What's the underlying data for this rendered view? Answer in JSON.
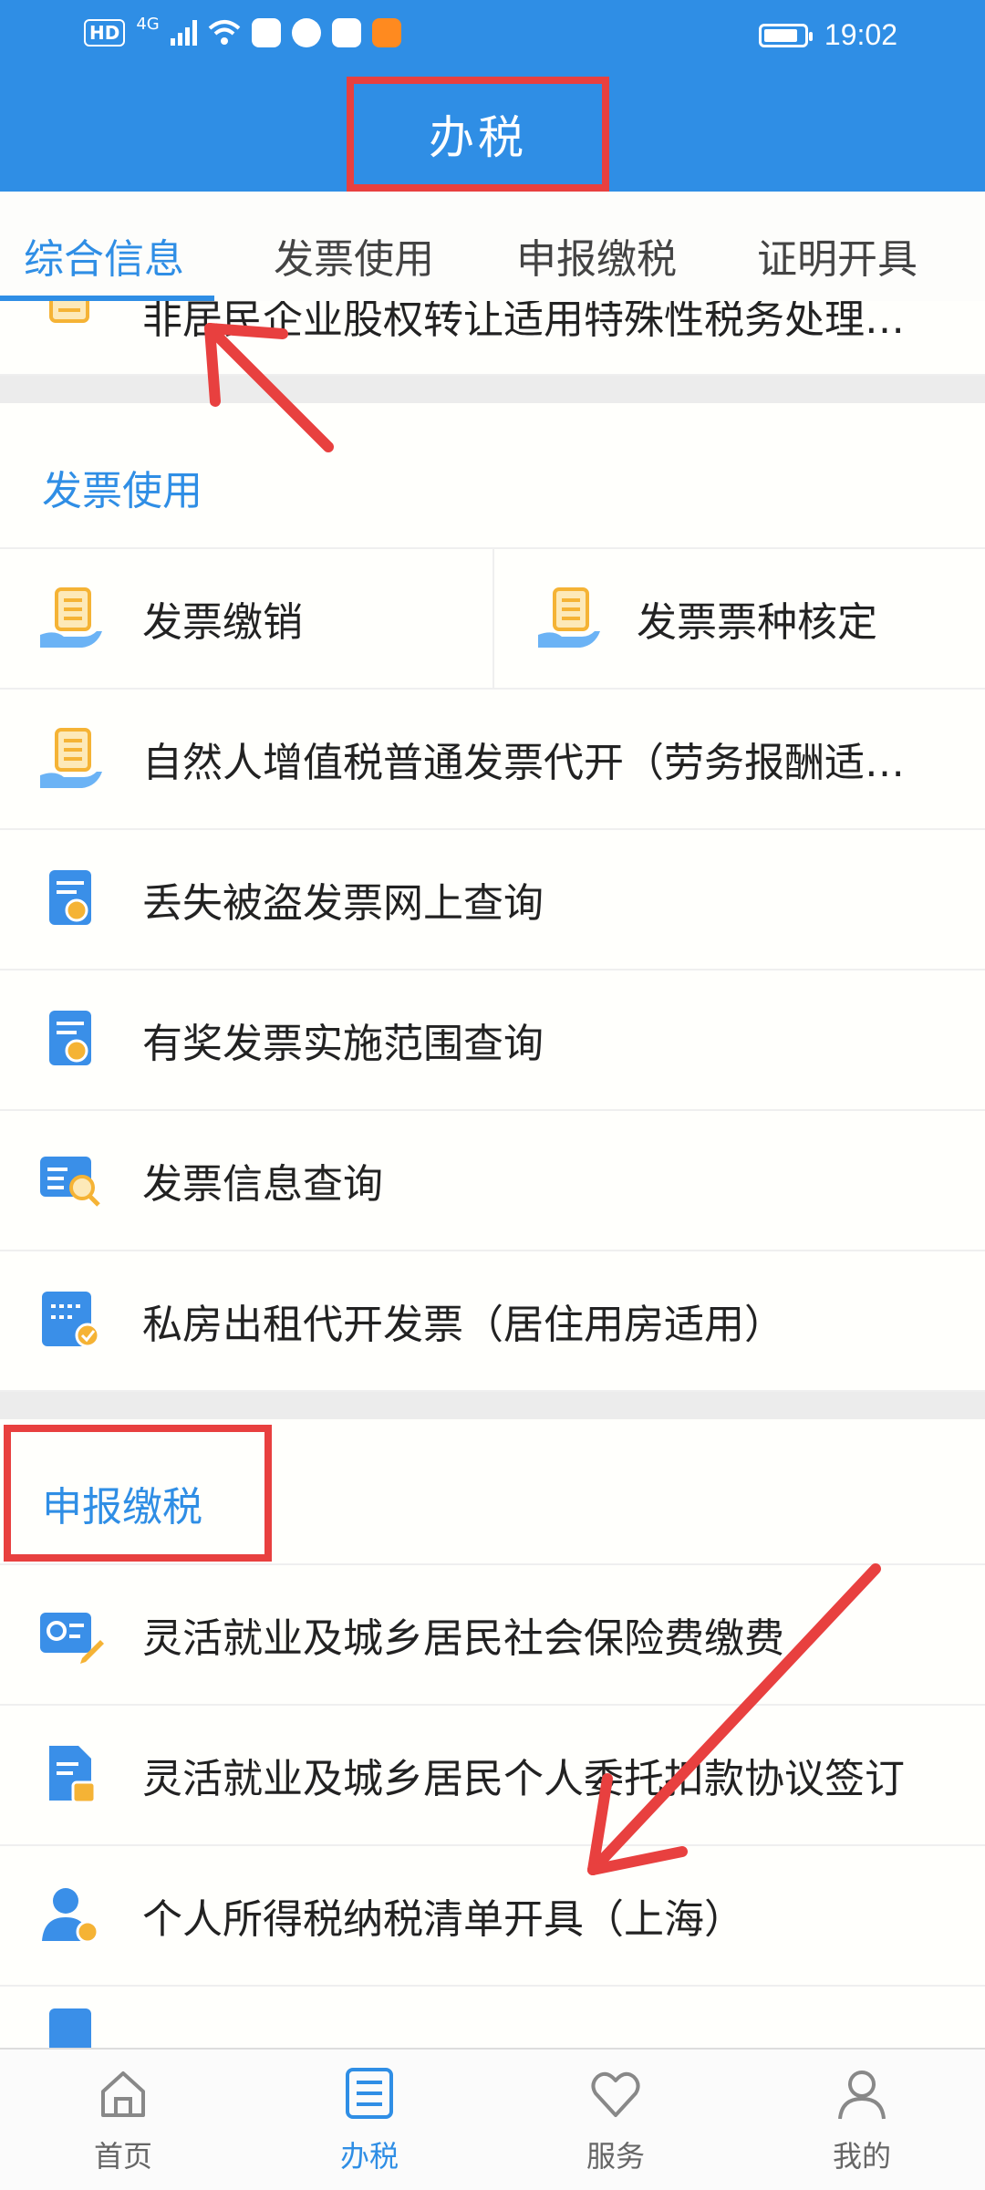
{
  "status_bar": {
    "hd": "HD",
    "network": "4G",
    "time": "19:02"
  },
  "header": {
    "title": "办税"
  },
  "tabs": [
    {
      "label": "综合信息",
      "active": true
    },
    {
      "label": "发票使用",
      "active": false
    },
    {
      "label": "申报缴税",
      "active": false
    },
    {
      "label": "证明开具",
      "active": false
    }
  ],
  "partial_item": {
    "label": "非居民企业股权转让适用特殊性税务处理…"
  },
  "sections": {
    "invoice": {
      "title": "发票使用",
      "items": [
        {
          "label": "发票缴销",
          "icon": "document-hand-icon"
        },
        {
          "label": "发票票种核定",
          "icon": "document-hand-icon"
        },
        {
          "label": "自然人增值税普通发票代开（劳务报酬适…",
          "icon": "document-hand-icon"
        },
        {
          "label": "丢失被盗发票网上查询",
          "icon": "certificate-icon"
        },
        {
          "label": "有奖发票实施范围查询",
          "icon": "certificate-icon"
        },
        {
          "label": "发票信息查询",
          "icon": "search-list-icon"
        },
        {
          "label": "私房出租代开发票（居住用房适用）",
          "icon": "ticket-check-icon"
        }
      ]
    },
    "declare": {
      "title": "申报缴税",
      "items": [
        {
          "label": "灵活就业及城乡居民社会保险费缴费",
          "icon": "card-edit-icon"
        },
        {
          "label": "灵活就业及城乡居民个人委托扣款协议签订",
          "icon": "document-stamp-icon"
        },
        {
          "label": "个人所得税纳税清单开具（上海）",
          "icon": "person-badge-icon"
        }
      ]
    }
  },
  "bottom_nav": [
    {
      "label": "首页",
      "icon": "home-icon",
      "active": false
    },
    {
      "label": "办税",
      "icon": "list-icon",
      "active": true
    },
    {
      "label": "服务",
      "icon": "heart-icon",
      "active": false
    },
    {
      "label": "我的",
      "icon": "person-icon",
      "active": false
    }
  ],
  "colors": {
    "primary": "#2f8ee5",
    "annotation_red": "#e8403f",
    "icon_orange": "#f5b335",
    "icon_blue": "#3a8fe8"
  }
}
